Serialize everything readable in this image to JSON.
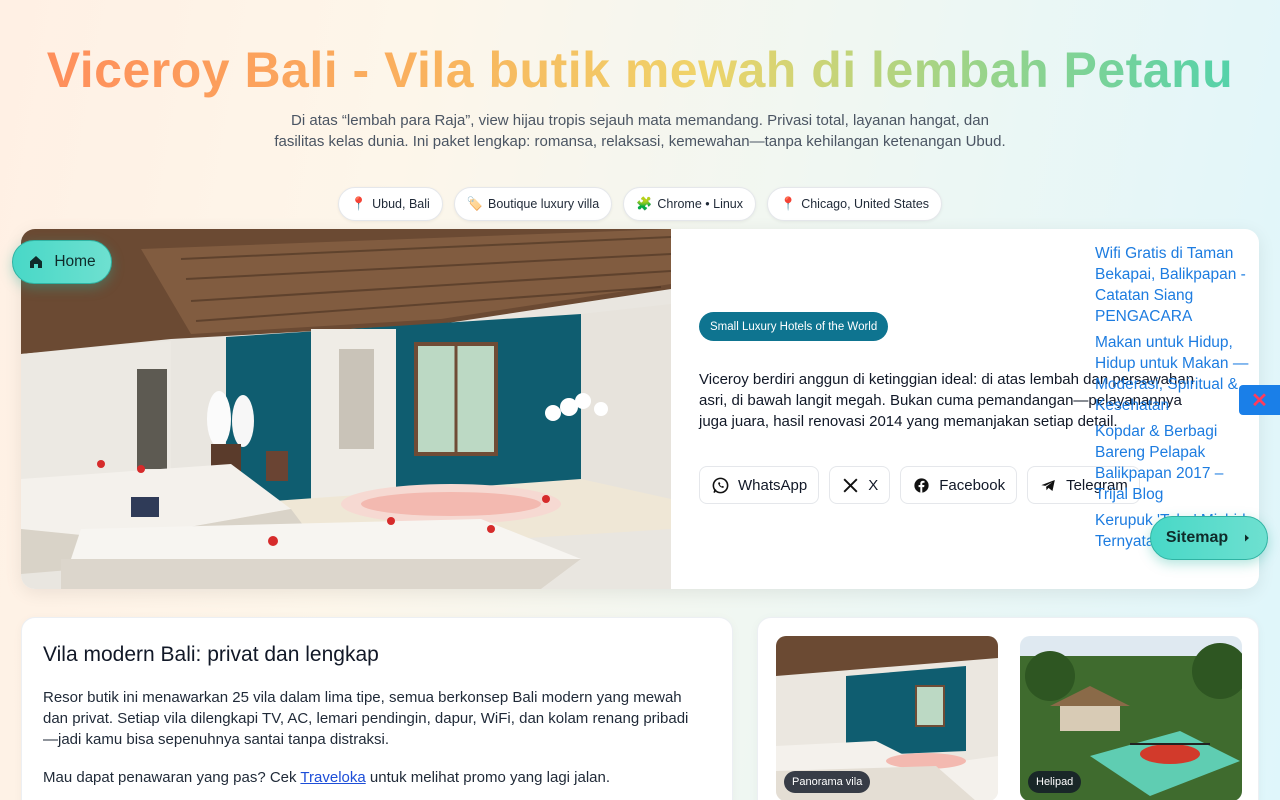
{
  "header": {
    "title": "Viceroy Bali - Vila butik mewah di lembah Petanu",
    "subtitle": "Di atas “lembah para Raja”, view hijau tropis sejauh mata memandang. Privasi total, layanan hangat, dan fasilitas kelas dunia. Ini paket lengkap: romansa, relaksasi, kemewahan—tanpa kehilangan ketenangan Ubud.",
    "chips": [
      {
        "icon": "pin-icon",
        "label": "Ubud, Bali"
      },
      {
        "icon": "tag-icon",
        "label": "Boutique luxury villa"
      },
      {
        "icon": "puzzle-icon",
        "label": "Chrome • Linux"
      },
      {
        "icon": "pin-icon",
        "label": "Chicago, United States"
      }
    ]
  },
  "nav": {
    "home_label": "Home",
    "sitemap_label": "Sitemap"
  },
  "hero": {
    "badge": "Small Luxury Hotels of the World",
    "description": "Viceroy berdiri anggun di ketinggian ideal: di atas lembah dan persawahan asri, di bawah langit megah. Bukan cuma pemandangan—pelayanannya juga juara, hasil renovasi 2014 yang memanjakan setiap detail.",
    "share": {
      "whatsapp": "WhatsApp",
      "x": "X",
      "facebook": "Facebook",
      "telegram": "Telegram"
    }
  },
  "related_links": [
    "Wifi Gratis di Taman Bekapai, Balikpapan - Catatan Siang PENGACARA",
    "Makan untuk Hidup, Hidup untuk Makan — Moderasi, Spiritual & Kesehatan",
    "Kopdar & Berbagi Bareng Pelapak Balikpapan 2017 – Trijal Blog",
    "Kerupuk 'Tahu' Misbid Ternyata..."
  ],
  "close_symbol": "✕",
  "info": {
    "title": "Vila modern Bali: privat dan lengkap",
    "paragraph": "Resor butik ini menawarkan 25 vila dalam lima tipe, semua berkonsep Bali modern yang mewah dan privat. Setiap vila dilengkapi TV, AC, lemari pendingin, dapur, WiFi, dan kolam renang pribadi—jadi kamu bisa sepenuhnya santai tanpa distraksi.",
    "offer_prefix": "Mau dapat penawaran yang pas? Cek ",
    "offer_link": "Traveloka",
    "offer_suffix": " untuk melihat promo yang lagi jalan."
  },
  "gallery": {
    "items": [
      {
        "label": "Panorama vila"
      },
      {
        "label": "Helipad"
      }
    ]
  },
  "colors": {
    "accent": "#48d8c7",
    "badge": "#0e7490",
    "link": "#1d7ce0"
  }
}
